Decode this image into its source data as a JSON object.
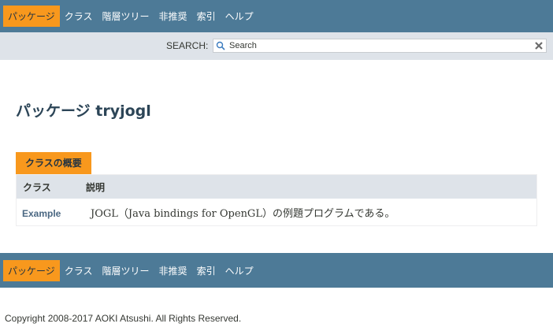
{
  "top_nav": {
    "items": [
      {
        "label": "パッケージ",
        "active": true
      },
      {
        "label": "クラス",
        "active": false
      },
      {
        "label": "階層ツリー",
        "active": false
      },
      {
        "label": "非推奨",
        "active": false
      },
      {
        "label": "索引",
        "active": false
      },
      {
        "label": "ヘルプ",
        "active": false
      }
    ]
  },
  "search": {
    "label": "SEARCH:",
    "placeholder": "Search"
  },
  "page_title": "パッケージ tryjogl",
  "class_summary": {
    "caption": "クラスの概要",
    "headers": [
      "クラス",
      "説明"
    ],
    "rows": [
      {
        "name": "Example",
        "description": "JOGL（Java bindings for OpenGL）の例題プログラムである。"
      }
    ]
  },
  "bottom_nav": {
    "items": [
      {
        "label": "パッケージ",
        "active": true
      },
      {
        "label": "クラス",
        "active": false
      },
      {
        "label": "階層ツリー",
        "active": false
      },
      {
        "label": "非推奨",
        "active": false
      },
      {
        "label": "索引",
        "active": false
      },
      {
        "label": "ヘルプ",
        "active": false
      }
    ]
  },
  "footer": {
    "copyright": "Copyright 2008-2017 AOKI Atsushi. All Rights Reserved."
  },
  "colors": {
    "navbar": "#4d7a97",
    "active_tab": "#f8981d",
    "subnav": "#dee3e9",
    "title": "#2c4557",
    "link": "#4a6782"
  }
}
